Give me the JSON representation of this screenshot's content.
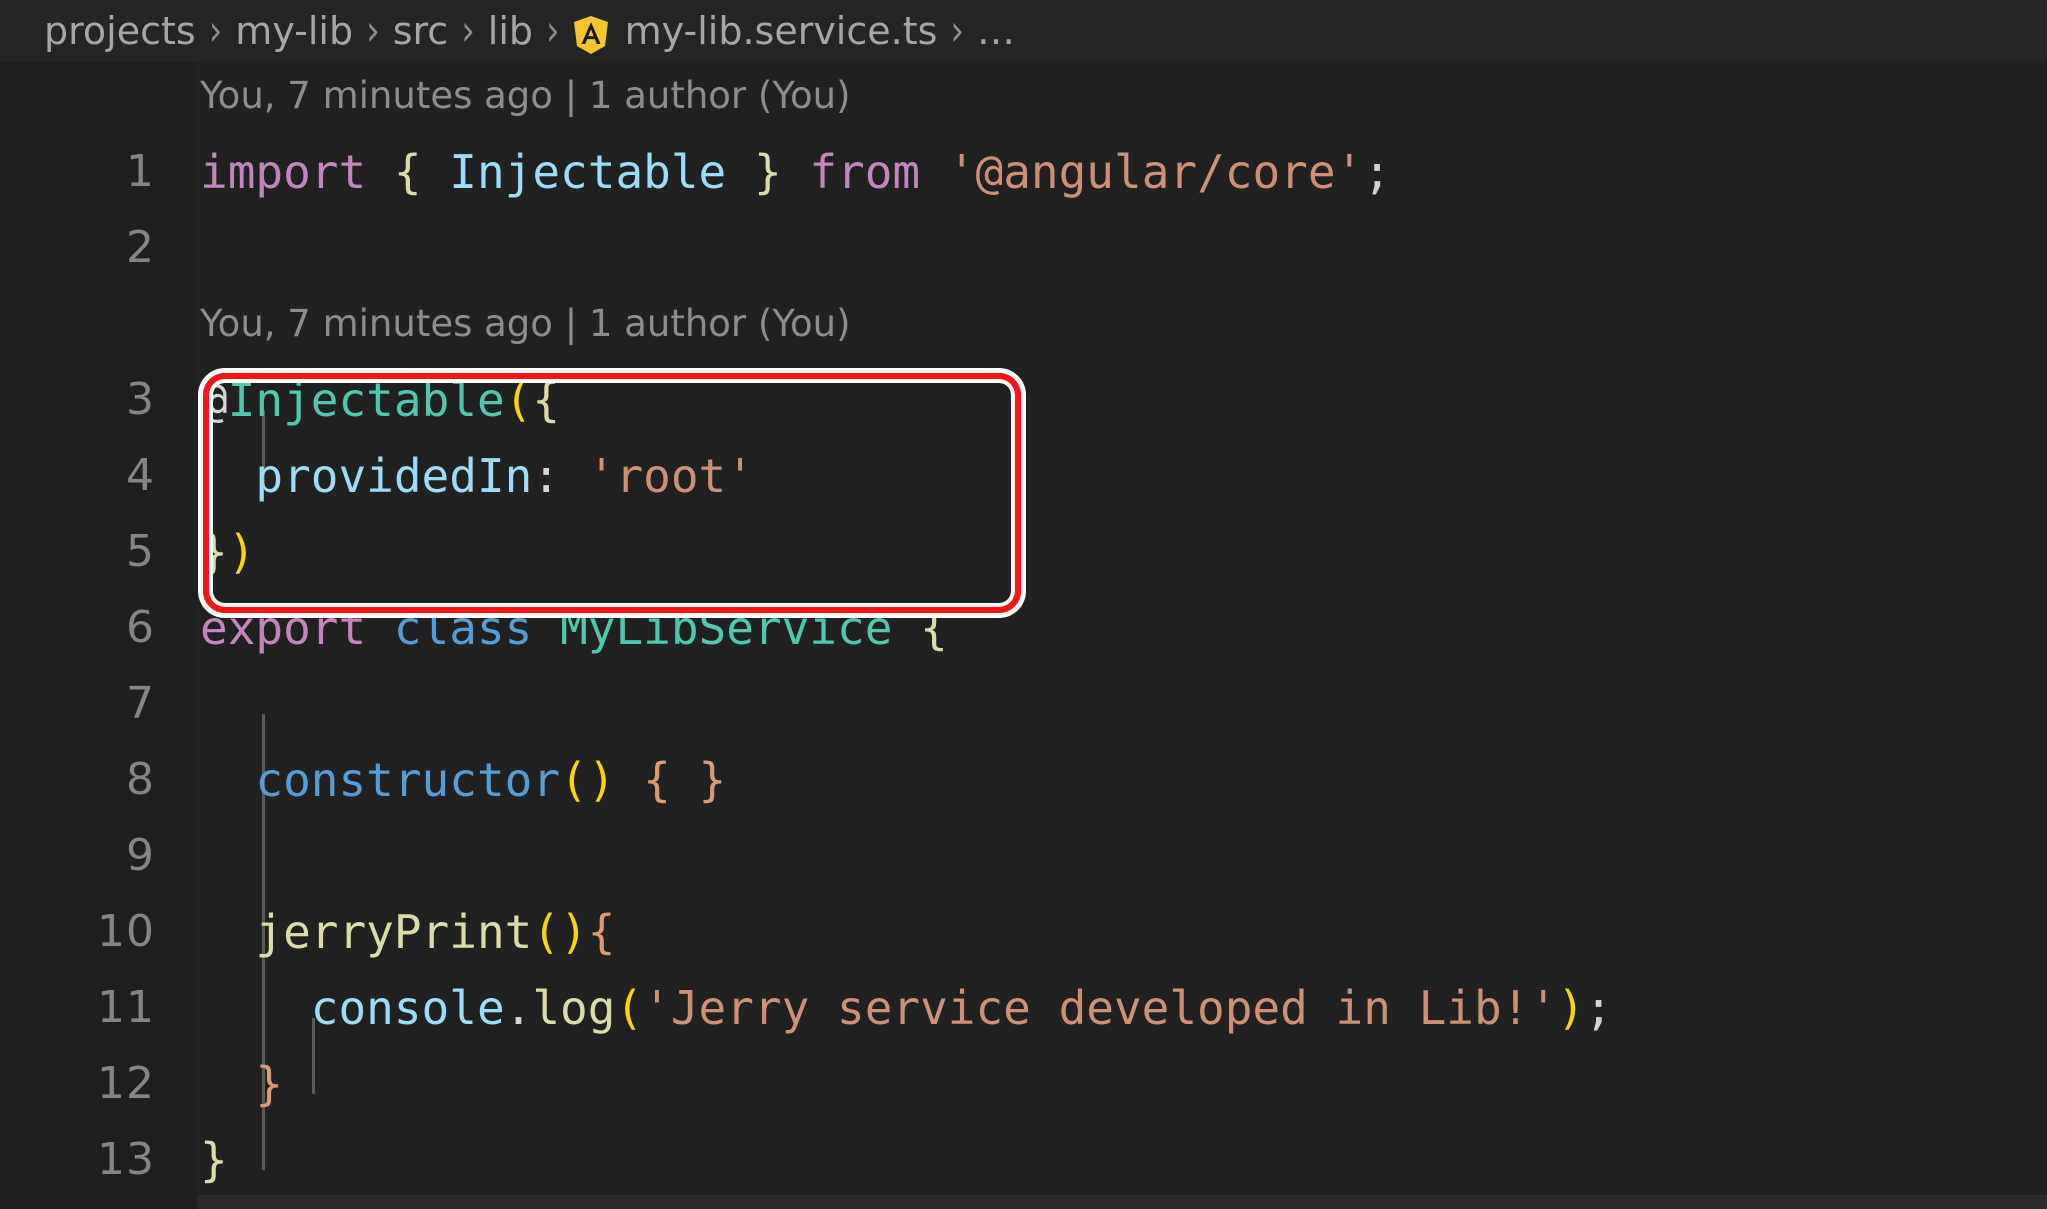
{
  "window": {
    "background": "#1f1f1f",
    "editor_background": "#212121"
  },
  "breadcrumb": {
    "separator": "›",
    "segments": [
      {
        "label": "projects",
        "icon": null
      },
      {
        "label": "my-lib",
        "icon": null
      },
      {
        "label": "src",
        "icon": null
      },
      {
        "label": "lib",
        "icon": null
      },
      {
        "label": "my-lib.service.ts",
        "icon": "angular-icon"
      },
      {
        "label": "…",
        "icon": null
      }
    ],
    "icon_color": "#f5c518"
  },
  "blame": {
    "line1": "You, 7 minutes ago | 1 author (You)",
    "line2": "You, 7 minutes ago | 1 author (You)",
    "color": "#8d8d8d"
  },
  "annotation": {
    "shape": "rounded-rectangle",
    "color": "#ff1414",
    "outline_color": "#ffffff",
    "covers_lines": "3-5"
  },
  "editor": {
    "language": "typescript",
    "file": "my-lib.service.ts",
    "line_numbers": [
      "1",
      "2",
      "3",
      "4",
      "5",
      "6",
      "7",
      "8",
      "9",
      "10",
      "11",
      "12",
      "13"
    ],
    "lines": [
      {
        "number": "1",
        "tokens": [
          {
            "text": "import",
            "cls": "t-kw"
          },
          {
            "text": " ",
            "cls": "t-plain"
          },
          {
            "text": "{",
            "cls": "t-brace-y"
          },
          {
            "text": " ",
            "cls": "t-plain"
          },
          {
            "text": "Injectable",
            "cls": "t-ident"
          },
          {
            "text": " ",
            "cls": "t-plain"
          },
          {
            "text": "}",
            "cls": "t-brace-y"
          },
          {
            "text": " ",
            "cls": "t-plain"
          },
          {
            "text": "from",
            "cls": "t-kw"
          },
          {
            "text": " ",
            "cls": "t-plain"
          },
          {
            "text": "'@angular/core'",
            "cls": "t-string"
          },
          {
            "text": ";",
            "cls": "t-punc"
          }
        ]
      },
      {
        "number": "2",
        "tokens": []
      },
      {
        "number": "3",
        "tokens": [
          {
            "text": "@",
            "cls": "t-plain"
          },
          {
            "text": "Injectable",
            "cls": "t-type"
          },
          {
            "text": "(",
            "cls": "t-brace-o"
          },
          {
            "text": "{",
            "cls": "t-brace-y"
          }
        ]
      },
      {
        "number": "4",
        "tokens": [
          {
            "text": "  ",
            "cls": "t-plain"
          },
          {
            "text": "providedIn",
            "cls": "t-ident"
          },
          {
            "text": ":",
            "cls": "t-punc"
          },
          {
            "text": " ",
            "cls": "t-plain"
          },
          {
            "text": "'root'",
            "cls": "t-string"
          }
        ]
      },
      {
        "number": "5",
        "tokens": [
          {
            "text": "}",
            "cls": "t-brace-y"
          },
          {
            "text": ")",
            "cls": "t-brace-o"
          }
        ]
      },
      {
        "number": "6",
        "tokens": [
          {
            "text": "export",
            "cls": "t-kw"
          },
          {
            "text": " ",
            "cls": "t-plain"
          },
          {
            "text": "class",
            "cls": "t-kw2"
          },
          {
            "text": " ",
            "cls": "t-plain"
          },
          {
            "text": "MyLibService",
            "cls": "t-type"
          },
          {
            "text": " ",
            "cls": "t-plain"
          },
          {
            "text": "{",
            "cls": "t-brace-y"
          }
        ]
      },
      {
        "number": "7",
        "tokens": []
      },
      {
        "number": "8",
        "tokens": [
          {
            "text": "  ",
            "cls": "t-plain"
          },
          {
            "text": "constructor",
            "cls": "t-kw2"
          },
          {
            "text": "()",
            "cls": "t-brace-o"
          },
          {
            "text": " ",
            "cls": "t-plain"
          },
          {
            "text": "{ }",
            "cls": "t-brace-p"
          }
        ]
      },
      {
        "number": "9",
        "tokens": []
      },
      {
        "number": "10",
        "tokens": [
          {
            "text": "  ",
            "cls": "t-plain"
          },
          {
            "text": "jerryPrint",
            "cls": "t-func"
          },
          {
            "text": "()",
            "cls": "t-brace-o"
          },
          {
            "text": "{",
            "cls": "t-brace-p"
          }
        ]
      },
      {
        "number": "11",
        "tokens": [
          {
            "text": "    ",
            "cls": "t-plain"
          },
          {
            "text": "console",
            "cls": "t-ident"
          },
          {
            "text": ".",
            "cls": "t-punc"
          },
          {
            "text": "log",
            "cls": "t-func"
          },
          {
            "text": "(",
            "cls": "t-brace-o"
          },
          {
            "text": "'Jerry service developed in Lib!'",
            "cls": "t-string"
          },
          {
            "text": ")",
            "cls": "t-brace-o"
          },
          {
            "text": ";",
            "cls": "t-punc"
          }
        ]
      },
      {
        "number": "12",
        "tokens": [
          {
            "text": "  ",
            "cls": "t-plain"
          },
          {
            "text": "}",
            "cls": "t-brace-p"
          }
        ]
      },
      {
        "number": "13",
        "tokens": [
          {
            "text": "}",
            "cls": "t-brace-y"
          }
        ]
      }
    ]
  }
}
